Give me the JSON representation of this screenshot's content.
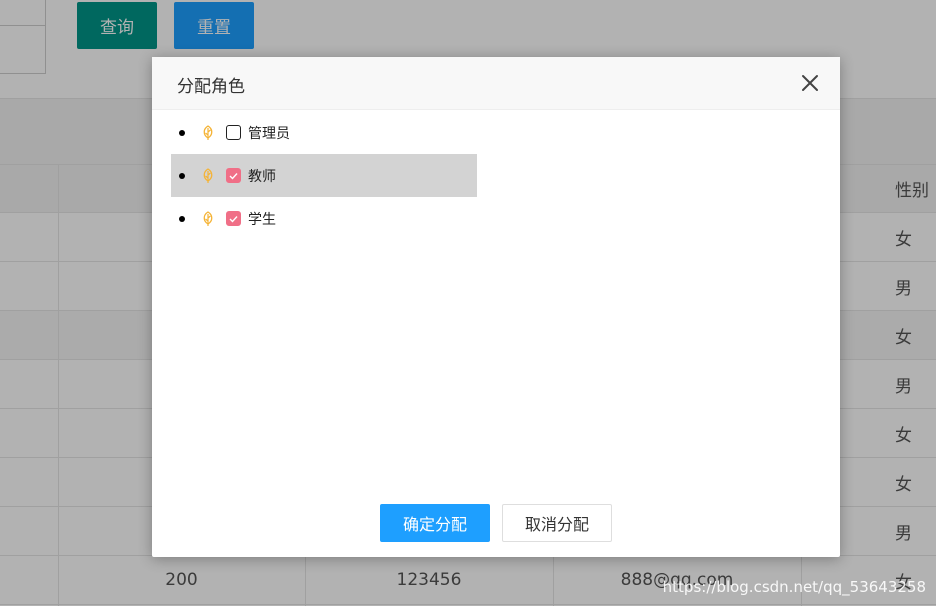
{
  "toolbar": {
    "query_label": "查询",
    "reset_label": "重置"
  },
  "table": {
    "gender_header": "性别",
    "genders": [
      "女",
      "男",
      "女",
      "男",
      "女",
      "女",
      "男",
      "女"
    ],
    "last_row": {
      "col2": "200",
      "col3": "123456",
      "col4": "888@qq.com"
    }
  },
  "dialog": {
    "title": "分配角色",
    "roles": [
      {
        "label": "管理员",
        "checked": false
      },
      {
        "label": "教师",
        "checked": true
      },
      {
        "label": "学生",
        "checked": true
      }
    ],
    "confirm_label": "确定分配",
    "cancel_label": "取消分配"
  },
  "watermark": "https://blog.csdn.net/qq_53643258",
  "colors": {
    "primary": "#1e9fff",
    "query": "#009688",
    "checkbox_on": "#f06f87",
    "leaf": "#f5b335"
  },
  "icons": {
    "leaf": "leaf-icon",
    "close": "close-icon",
    "check": "check-icon"
  }
}
